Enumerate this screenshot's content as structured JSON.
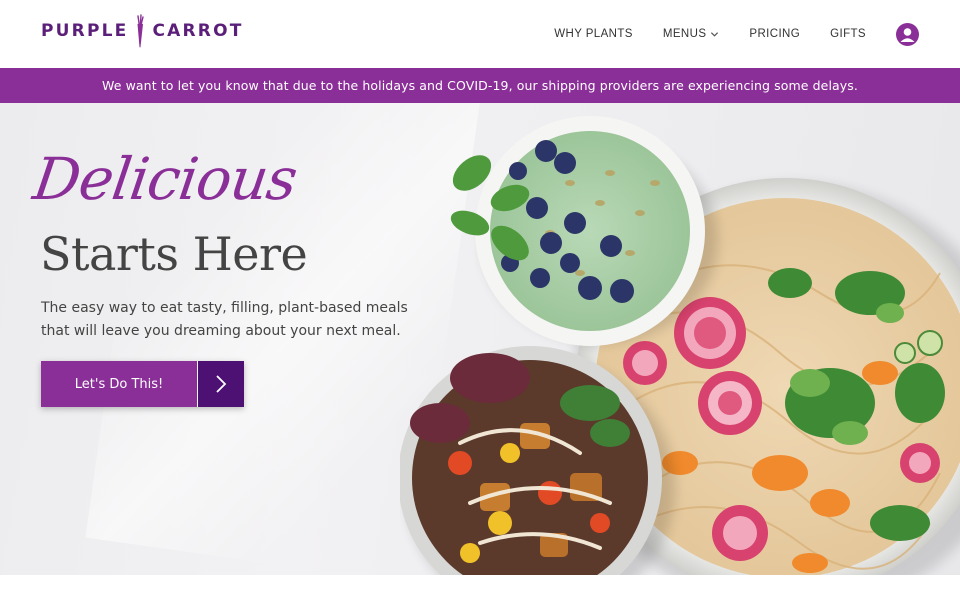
{
  "brand": {
    "logo_left": "PURPLE",
    "logo_right": "CARROT",
    "primary_color": "#8b2f98",
    "dark_purple": "#4d1173"
  },
  "nav": {
    "items": [
      {
        "label": "WHY PLANTS"
      },
      {
        "label": "MENUS",
        "has_dropdown": true
      },
      {
        "label": "PRICING"
      },
      {
        "label": "GIFTS"
      }
    ],
    "account_icon": "user-icon"
  },
  "banner": {
    "text": "We want to let you know that due to the holidays and COVID-19, our shipping providers are experiencing some delays."
  },
  "hero": {
    "script_title": "Delicious",
    "headline": "Starts Here",
    "subcopy": "The easy way to eat tasty, filling, plant-based meals that will leave you dreaming about your next meal.",
    "cta_label": "Let's Do This!",
    "cta_icon": "chevron-right-icon"
  }
}
